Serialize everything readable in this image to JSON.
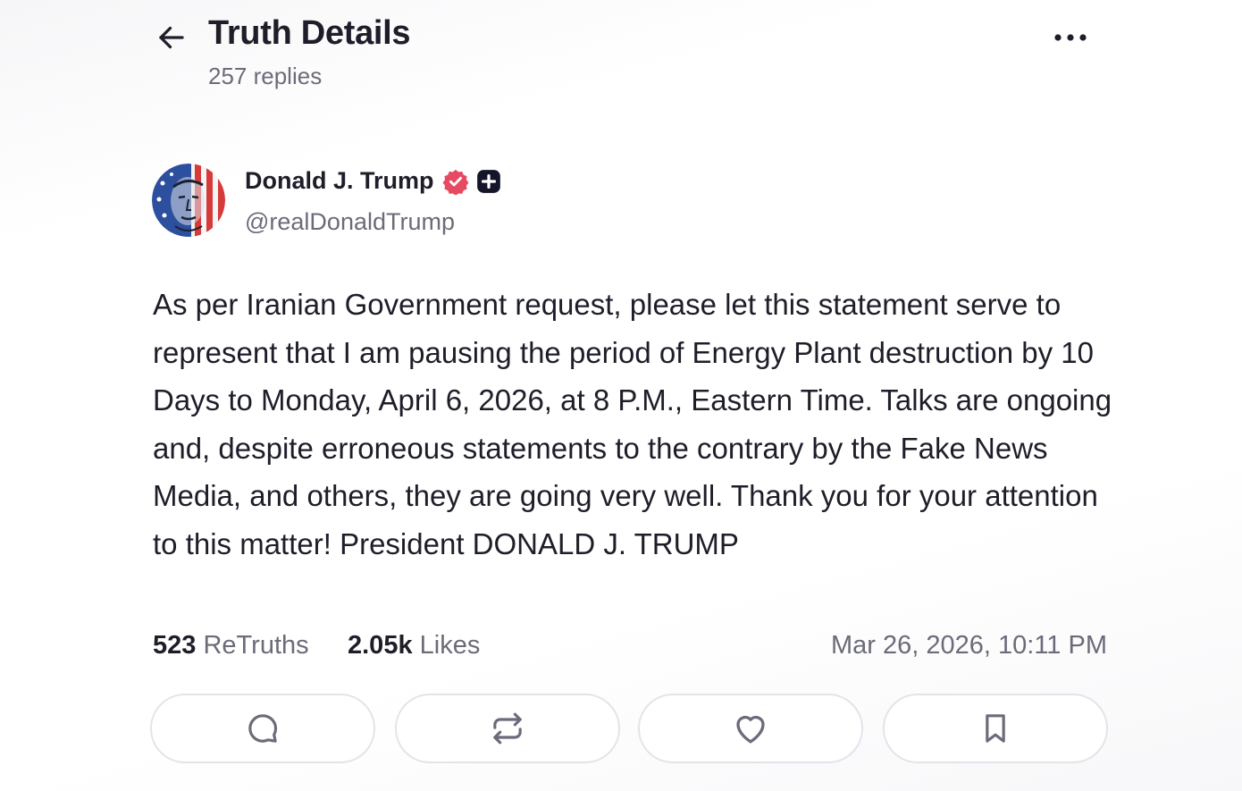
{
  "header": {
    "title": "Truth Details",
    "replies": "257 replies",
    "back_icon": "arrow-left-icon",
    "more_icon": "ellipsis-icon"
  },
  "author": {
    "name": "Donald J. Trump",
    "handle": "@realDonaldTrump",
    "avatar": "flag-portrait-avatar",
    "verified_color": "#e64a63",
    "badges": [
      "verified-badge-icon",
      "plus-badge-icon"
    ]
  },
  "post": {
    "text": "As per Iranian Government request, please let this statement serve to represent that I am pausing the period of Energy Plant destruction by 10 Days to Monday, April 6, 2026, at 8 P.M., Eastern Time. Talks are ongoing and, despite erroneous statements to the contrary by the Fake News Media, and others, they are going very well. Thank you for your attention to this matter! President DONALD J. TRUMP"
  },
  "stats": {
    "retruths_count": "523",
    "retruths_label": "ReTruths",
    "likes_count": "2.05k",
    "likes_label": "Likes",
    "timestamp": "Mar 26, 2026, 10:11 PM"
  },
  "actions": [
    {
      "icon": "reply-icon"
    },
    {
      "icon": "retruth-icon"
    },
    {
      "icon": "heart-icon"
    },
    {
      "icon": "bookmark-icon"
    }
  ],
  "colors": {
    "text_primary": "#1e1e2a",
    "text_secondary": "#6b6b7a",
    "border": "#e3e3ea",
    "icon": "#6b6b7a"
  }
}
